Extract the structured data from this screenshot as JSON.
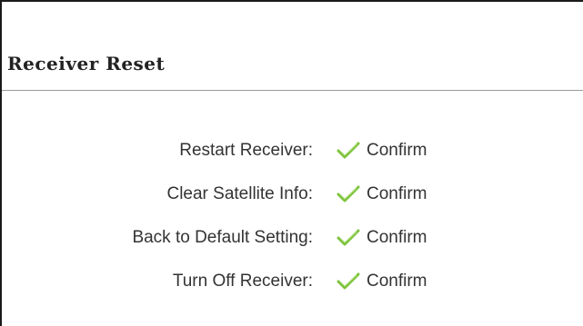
{
  "page": {
    "title": "Receiver Reset"
  },
  "rows": [
    {
      "label": "Restart Receiver:",
      "action_label": "Confirm",
      "action_icon": "check-icon"
    },
    {
      "label": "Clear Satellite Info:",
      "action_label": "Confirm",
      "action_icon": "check-icon"
    },
    {
      "label": "Back to Default Setting:",
      "action_label": "Confirm",
      "action_icon": "check-icon"
    },
    {
      "label": "Turn Off Receiver:",
      "action_label": "Confirm",
      "action_icon": "check-icon"
    }
  ],
  "colors": {
    "check": "#7cc33b",
    "text": "#333333",
    "border": "#1a1a1a",
    "divider": "#9a9a9a"
  }
}
